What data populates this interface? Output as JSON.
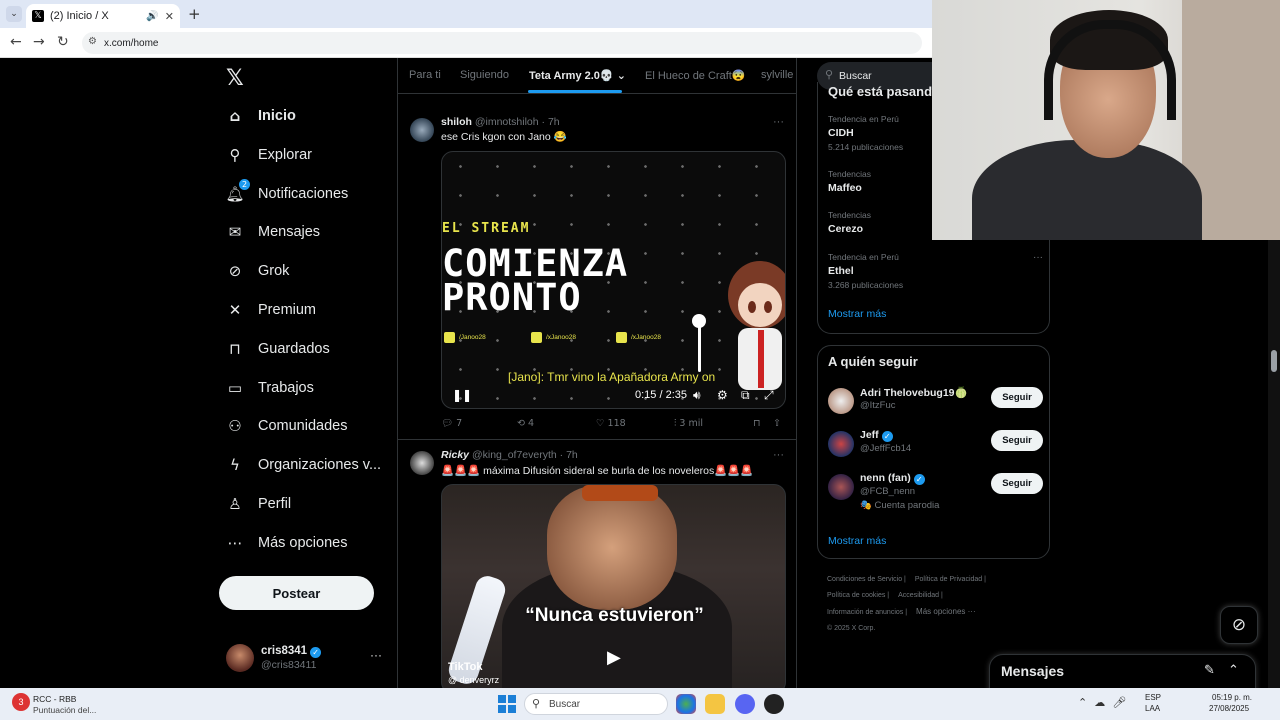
{
  "browser": {
    "tab_title": "(2) Inicio / X",
    "tab_icon": "x-logo-icon",
    "url": "x.com/home"
  },
  "nav": {
    "items": [
      {
        "label": "Inicio",
        "icon": "home-icon",
        "active": true
      },
      {
        "label": "Explorar",
        "icon": "search-icon"
      },
      {
        "label": "Notificaciones",
        "icon": "bell-icon",
        "badge": "2"
      },
      {
        "label": "Mensajes",
        "icon": "mail-icon"
      },
      {
        "label": "Grok",
        "icon": "grok-icon"
      },
      {
        "label": "Premium",
        "icon": "x-logo-icon"
      },
      {
        "label": "Guardados",
        "icon": "bookmark-icon"
      },
      {
        "label": "Trabajos",
        "icon": "briefcase-icon"
      },
      {
        "label": "Comunidades",
        "icon": "people-icon"
      },
      {
        "label": "Organizaciones v...",
        "icon": "lightning-icon"
      },
      {
        "label": "Perfil",
        "icon": "person-icon"
      },
      {
        "label": "Más opciones",
        "icon": "more-circle-icon"
      }
    ],
    "post_label": "Postear"
  },
  "account": {
    "name": "cris8341",
    "handle": "@cris83411"
  },
  "feed_tabs": [
    "Para ti",
    "Siguiendo",
    "Teta Army 2.0💀",
    "El Hueco de Craft😨",
    "sylville"
  ],
  "tweets": [
    {
      "name": "shiloh",
      "handle": "@imnotshiloh",
      "time": "· 7h",
      "text": "ese Cris kgon con Jano 😂",
      "video": {
        "eyebrow": "EL STREAM",
        "headline": "COMIENZA\nPRONTO",
        "socials": [
          "/Janoo28",
          "/xJanoo28",
          "/xJanoo28"
        ],
        "subtitle": "[Jano]: Tmr vino la Apañadora Army on",
        "time": "0:15 / 2:35"
      },
      "replies": "7",
      "reposts": "4",
      "likes": "118",
      "views": "3 mil"
    },
    {
      "name": "Ricky",
      "handle": "@king_of7everyth",
      "time": "· 7h",
      "text": "🚨🚨🚨 máxima Difusión sideral se burla de los noveleros🚨🚨🚨",
      "video": {
        "caption": "“Nunca estuvieron”",
        "tiktok": "TikTok",
        "tiktok_handle": "@ denveryrz"
      }
    }
  ],
  "sidebar": {
    "search_placeholder": "Buscar",
    "trends_title": "Qué está pasando",
    "trends": [
      {
        "context": "Tendencia en Perú",
        "name": "CIDH",
        "count": "5.214 publicaciones"
      },
      {
        "context": "Tendencias",
        "name": "Maffeo",
        "count": ""
      },
      {
        "context": "Tendencias",
        "name": "Cerezo",
        "count": ""
      },
      {
        "context": "Tendencia en Perú",
        "name": "Ethel",
        "count": "3.268 publicaciones"
      }
    ],
    "trends_more": "Mostrar más",
    "follow_title": "A quién seguir",
    "follow": [
      {
        "name": "Adri Thelovebug19🍈",
        "handle": "@ItzFuc",
        "extra": "",
        "button": "Seguir"
      },
      {
        "name": "Jeff",
        "handle": "@JeffFcb14",
        "extra": "",
        "button": "Seguir",
        "verified": true
      },
      {
        "name": "nenn (fan)",
        "handle": "@FCB_nenn",
        "extra": "🎭 Cuenta parodia",
        "button": "Seguir",
        "verified": true
      }
    ],
    "follow_more": "Mostrar más",
    "footer": [
      "Condiciones de Servicio |",
      "Política de Privacidad |",
      "Política de cookies |",
      "Accesibilidad |",
      "Información de anuncios |",
      "Más opciones ···",
      "© 2025 X Corp."
    ]
  },
  "messages": {
    "title": "Mensajes"
  },
  "taskbar": {
    "app_title": "RCC - RBB",
    "app_subtitle": "Puntuación del...",
    "app_badge": "3",
    "search": "Buscar",
    "lang1": "ESP",
    "lang2": "LAA",
    "time": "05:19 p. m.",
    "date": "27/08/2025"
  },
  "colors": {
    "accent": "#1d9bf0",
    "background": "#000000",
    "border": "#2f3336",
    "muted_text": "#71767b",
    "video_yellow": "#e8e44c"
  }
}
